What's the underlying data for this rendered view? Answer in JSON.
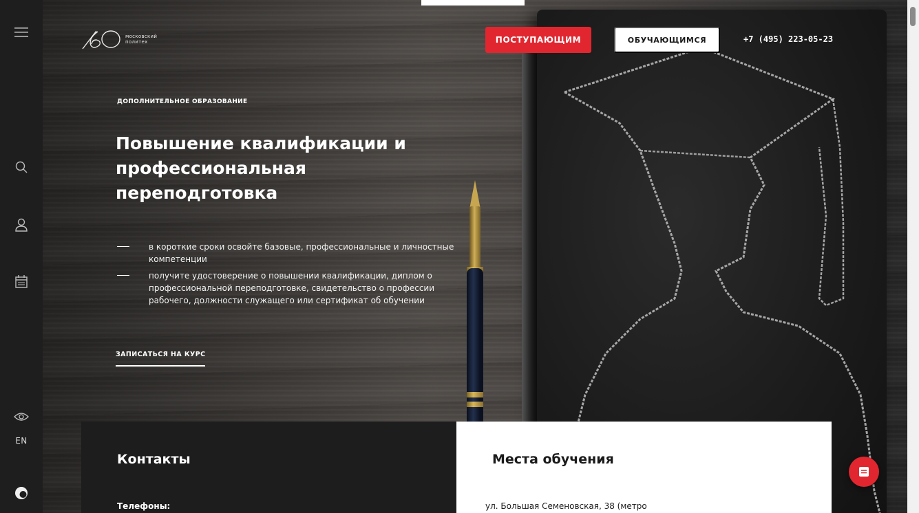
{
  "header": {
    "logo_line1": "московский",
    "logo_line2": "политех",
    "btn_applicants": "ПОСТУПАЮЩИМ",
    "btn_students": "ОБУЧАЮЩИМСЯ",
    "phone": "+7 (495) 223-05-23"
  },
  "sidebar": {
    "lang": "EN",
    "icons": [
      "menu-icon",
      "search-icon",
      "user-icon",
      "calendar-icon",
      "eye-icon",
      "app-logo-icon"
    ]
  },
  "hero": {
    "overline": "ДОПОЛНИТЕЛЬНОЕ ОБРАЗОВАНИЕ",
    "title": "Повышение квалификации и профессиональная переподготовка",
    "bullets": [
      "в короткие сроки освойте базовые, профессиональные и личностные компетенции",
      "получите удостоверение о повышении квалификации, диплом о профессиональной переподготовке, свидетельство о профессии рабочего, должности служащего или сертификат об обучении"
    ],
    "cta": "ЗАПИСАТЬСЯ НА КУРС"
  },
  "contacts": {
    "heading": "Контакты",
    "phones_label": "Телефоны:"
  },
  "locations": {
    "heading": "Места обучения",
    "address": "ул. Большая Семеновская, 38 (метро"
  },
  "colors": {
    "accent": "#e1262f",
    "sidebar": "#1e1e1e",
    "panel_dark": "#1d1d1d"
  }
}
